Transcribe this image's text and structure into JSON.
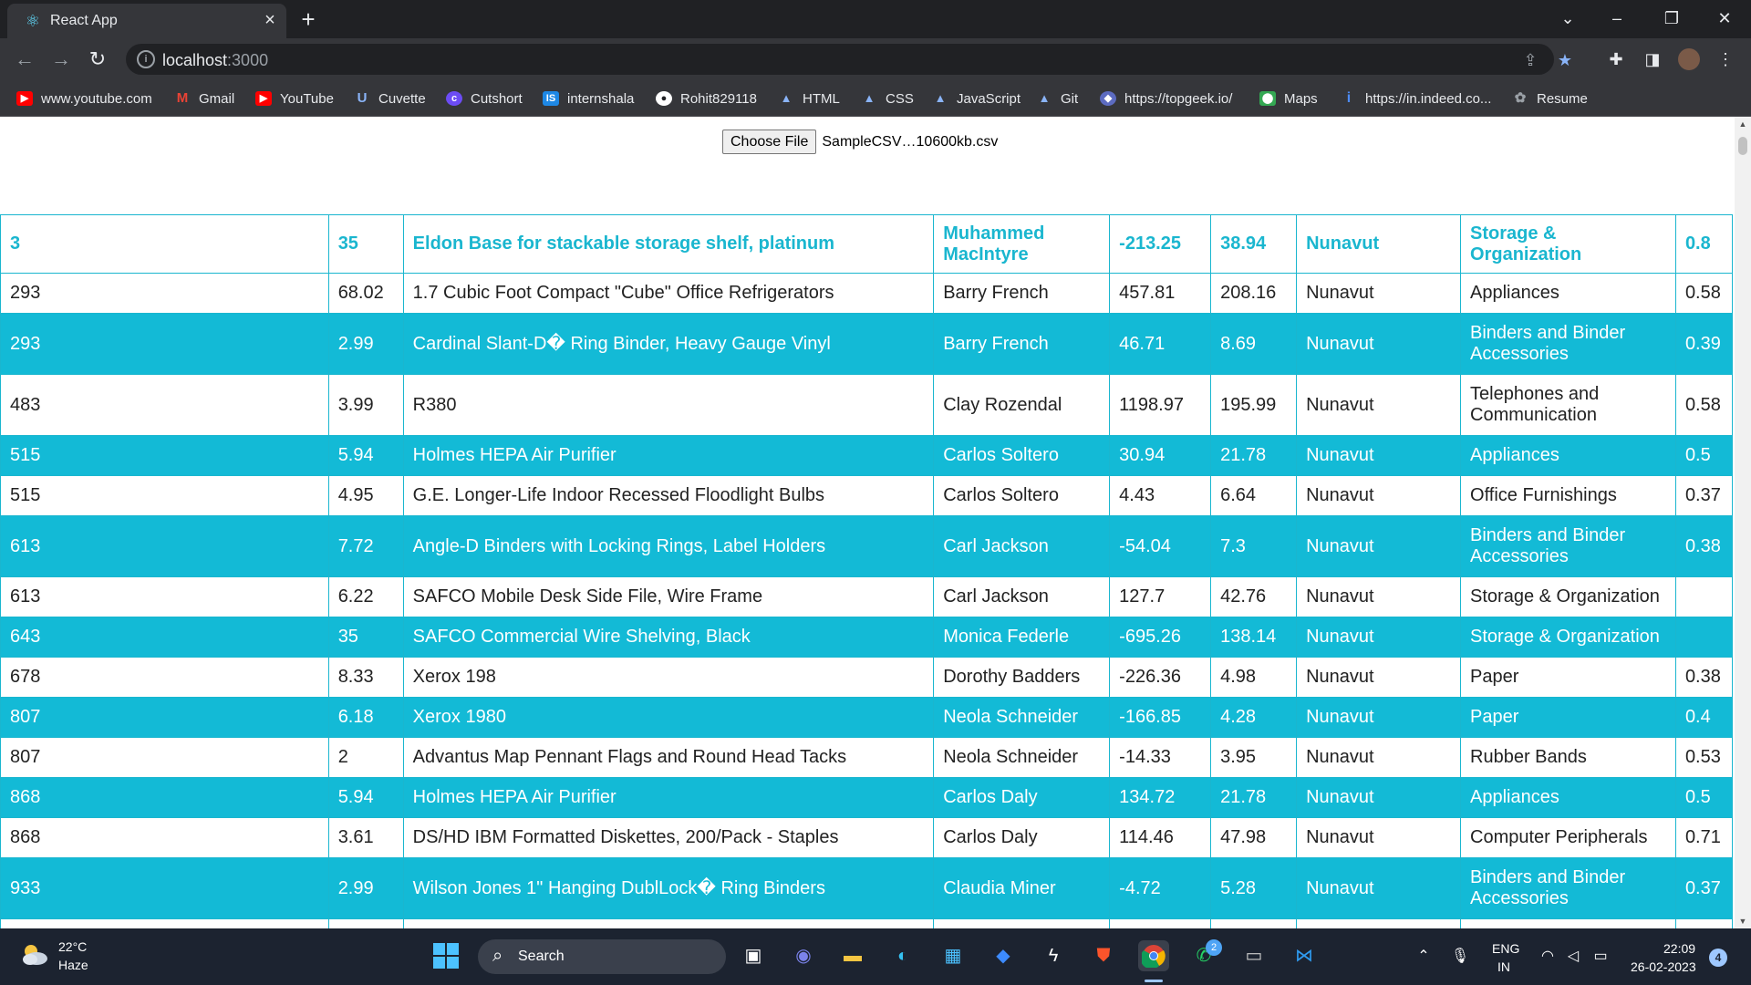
{
  "browser": {
    "tab_title": "React App",
    "url_host": "localhost",
    "url_port": ":3000",
    "bookmarks": [
      {
        "label": "www.youtube.com",
        "icon": "youtube-icon",
        "color": "#ff0000"
      },
      {
        "label": "Gmail",
        "icon": "gmail-icon",
        "color": "#ea4335"
      },
      {
        "label": "YouTube",
        "icon": "youtube-icon",
        "color": "#ff0000"
      },
      {
        "label": "Cuvette",
        "icon": "cuvette-icon",
        "color": "#4a6cf7"
      },
      {
        "label": "Cutshort",
        "icon": "cutshort-icon",
        "color": "#6c4cf5"
      },
      {
        "label": "internshala",
        "icon": "internshala-icon",
        "color": "#1e88e5"
      },
      {
        "label": "Rohit829118",
        "icon": "github-icon",
        "color": "#ffffff"
      },
      {
        "label": "HTML",
        "icon": "folder-mountain-icon",
        "color": "#8ab4f8"
      },
      {
        "label": "CSS",
        "icon": "folder-mountain-icon",
        "color": "#8ab4f8"
      },
      {
        "label": "JavaScript",
        "icon": "folder-mountain-icon",
        "color": "#8ab4f8"
      },
      {
        "label": "Git",
        "icon": "folder-mountain-icon",
        "color": "#8ab4f8"
      },
      {
        "label": "https://topgeek.io/",
        "icon": "topgeek-icon",
        "color": "#5c6bc0"
      },
      {
        "label": "Maps",
        "icon": "maps-icon",
        "color": "#34a853"
      },
      {
        "label": "https://in.indeed.co...",
        "icon": "indeed-icon",
        "color": "#2164f3"
      },
      {
        "label": "Resume",
        "icon": "resume-icon",
        "color": "#9aa0a6"
      }
    ]
  },
  "file_input": {
    "button_label": "Choose File",
    "file_name": "SampleCSV…10600kb.csv"
  },
  "table": {
    "header": [
      "3",
      "35",
      "Eldon Base for stackable storage shelf, platinum",
      "Muhammed MacIntyre",
      "-213.25",
      "38.94",
      "Nunavut",
      "Storage & Organization",
      "0.8"
    ],
    "rows": [
      [
        "293",
        "68.02",
        "1.7 Cubic Foot Compact \"Cube\" Office Refrigerators",
        "Barry French",
        "457.81",
        "208.16",
        "Nunavut",
        "Appliances",
        "0.58"
      ],
      [
        "293",
        "2.99",
        "Cardinal Slant-D� Ring Binder, Heavy Gauge Vinyl",
        "Barry French",
        "46.71",
        "8.69",
        "Nunavut",
        "Binders and Binder Accessories",
        "0.39"
      ],
      [
        "483",
        "3.99",
        "R380",
        "Clay Rozendal",
        "1198.97",
        "195.99",
        "Nunavut",
        "Telephones and Communication",
        "0.58"
      ],
      [
        "515",
        "5.94",
        "Holmes HEPA Air Purifier",
        "Carlos Soltero",
        "30.94",
        "21.78",
        "Nunavut",
        "Appliances",
        "0.5"
      ],
      [
        "515",
        "4.95",
        "G.E. Longer-Life Indoor Recessed Floodlight Bulbs",
        "Carlos Soltero",
        "4.43",
        "6.64",
        "Nunavut",
        "Office Furnishings",
        "0.37"
      ],
      [
        "613",
        "7.72",
        "Angle-D Binders with Locking Rings, Label Holders",
        "Carl Jackson",
        "-54.04",
        "7.3",
        "Nunavut",
        "Binders and Binder Accessories",
        "0.38"
      ],
      [
        "613",
        "6.22",
        "SAFCO Mobile Desk Side File, Wire Frame",
        "Carl Jackson",
        "127.7",
        "42.76",
        "Nunavut",
        "Storage & Organization",
        ""
      ],
      [
        "643",
        "35",
        "SAFCO Commercial Wire Shelving, Black",
        "Monica Federle",
        "-695.26",
        "138.14",
        "Nunavut",
        "Storage & Organization",
        ""
      ],
      [
        "678",
        "8.33",
        "Xerox 198",
        "Dorothy Badders",
        "-226.36",
        "4.98",
        "Nunavut",
        "Paper",
        "0.38"
      ],
      [
        "807",
        "6.18",
        "Xerox 1980",
        "Neola Schneider",
        "-166.85",
        "4.28",
        "Nunavut",
        "Paper",
        "0.4"
      ],
      [
        "807",
        "2",
        "Advantus Map Pennant Flags and Round Head Tacks",
        "Neola Schneider",
        "-14.33",
        "3.95",
        "Nunavut",
        "Rubber Bands",
        "0.53"
      ],
      [
        "868",
        "5.94",
        "Holmes HEPA Air Purifier",
        "Carlos Daly",
        "134.72",
        "21.78",
        "Nunavut",
        "Appliances",
        "0.5"
      ],
      [
        "868",
        "3.61",
        "DS/HD IBM Formatted Diskettes, 200/Pack - Staples",
        "Carlos Daly",
        "114.46",
        "47.98",
        "Nunavut",
        "Computer Peripherals",
        "0.71"
      ],
      [
        "933",
        "2.99",
        "Wilson Jones 1\" Hanging DublLock� Ring Binders",
        "Claudia Miner",
        "-4.72",
        "5.28",
        "Nunavut",
        "Binders and Binder Accessories",
        "0.37"
      ],
      [
        "",
        "",
        "",
        "",
        "",
        "",
        "",
        "",
        ""
      ]
    ],
    "colors": {
      "accent": "#13bad6",
      "header_text": "#1ab6cf"
    }
  },
  "taskbar": {
    "weather_temp": "22°C",
    "weather_desc": "Haze",
    "search_label": "Search",
    "lang_top": "ENG",
    "lang_bottom": "IN",
    "time": "22:09",
    "date": "26-02-2023",
    "notification_count": "4",
    "whatsapp_badge": "2"
  }
}
